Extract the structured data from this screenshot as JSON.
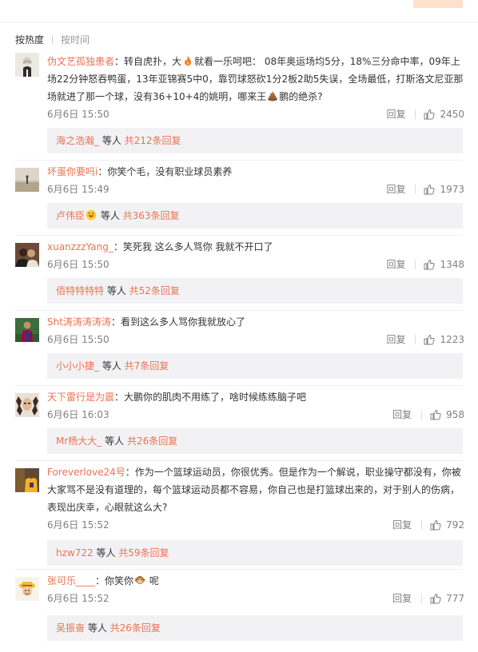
{
  "sort": {
    "hot": "按热度",
    "time": "按时间"
  },
  "reply_label": "回复",
  "comments": [
    {
      "user": "伪文艺孤独患者",
      "colon": "：",
      "text_a": "转自虎扑，大",
      "text_b": "就看一乐呵吧： 08年奥运场均5分，18%三分命中率，09年上场22分钟怒吞鸭蛋，13年亚锦赛5中0，靠罚球怒砍1分2板2助5失误，全场最低，打斯洛文尼亚那场就进了那一个球，没有36+10+4的姚明，哪来王",
      "text_c": "鹏的绝杀?",
      "emoji1": "fire-emoji",
      "emoji2": "poop-emoji",
      "time": "6月6日 15:50",
      "likes": "2450",
      "reply_user": "海之浩瀚_",
      "reply_mid": " 等人 ",
      "reply_total": "共212条回复"
    },
    {
      "user": "坏蛋你要吗i",
      "colon": "：",
      "text": "你笑个毛，没有职业球员素养",
      "time": "6月6日 15:49",
      "likes": "1973",
      "reply_user": "卢伟臣",
      "reply_emoji": "grin-emoji",
      "reply_mid": " 等人 ",
      "reply_total": "共363条回复"
    },
    {
      "user": "xuanzzzYang_",
      "colon": "：",
      "text": "笑死我 这么多人骂你 我就不开口了",
      "time": "6月6日 15:50",
      "likes": "1348",
      "reply_user": "佰特特特特",
      "reply_mid": " 等人 ",
      "reply_total": "共52条回复"
    },
    {
      "user": "Sht涛涛涛涛涛",
      "colon": "：",
      "text": "看到这么多人骂你我就放心了",
      "time": "6月6日 15:50",
      "likes": "1223",
      "reply_user": "小小小捷_",
      "reply_mid": " 等人 ",
      "reply_total": "共7条回复"
    },
    {
      "user": "天下雷行是为震",
      "colon": "：",
      "text": "大鹏你的肌肉不用练了，啥时候练练脑子吧",
      "time": "6月6日 16:03",
      "likes": "958",
      "reply_user": "Mr杨大大_",
      "reply_mid": " 等人 ",
      "reply_total": "共26条回复"
    },
    {
      "user": "Foreverlove24号",
      "colon": "：",
      "text": "作为一个篮球运动员，你很优秀。但是作为一个解说，职业操守都没有，你被大家骂不是没有道理的，每个篮球运动员都不容易，你自己也是打篮球出来的，对于别人的伤病，表现出庆幸，心眼就这么大?",
      "time": "6月6日 15:52",
      "likes": "792",
      "reply_user": "hzw722",
      "reply_mid": " 等人 ",
      "reply_total": "共59条回复"
    },
    {
      "user": "张可乐____",
      "colon": "：",
      "text_a": "你笑你",
      "text_b": " 呢",
      "emoji1": "monkey-emoji",
      "time": "6月6日 15:52",
      "likes": "777",
      "reply_user": "吴振奋",
      "reply_mid": " 等人 ",
      "reply_total": "共26条回复"
    }
  ],
  "colors": {
    "username": "#eb7350",
    "meta": "#808080",
    "reply_bg": "#f2f2f5"
  }
}
